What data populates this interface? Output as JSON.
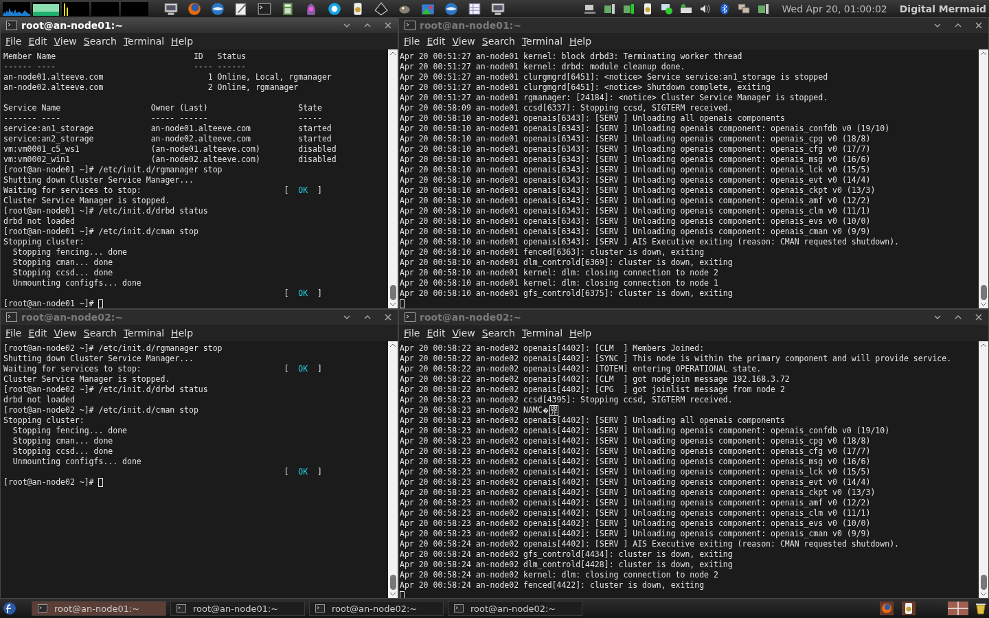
{
  "top_panel": {
    "clock": "Wed Apr 20, 01:00:02",
    "user": "Digital Mermaid"
  },
  "windows": [
    {
      "title": "root@an-node01:~",
      "active": true,
      "menu": [
        "File",
        "Edit",
        "View",
        "Search",
        "Terminal",
        "Help"
      ],
      "lines": [
        {
          "text": "Member Name                             ID   Status"
        },
        {
          "text": "------ ----                             ---- ------"
        },
        {
          "text": "an-node01.alteeve.com                      1 Online, Local, rgmanager"
        },
        {
          "text": "an-node02.alteeve.com                      2 Online, rgmanager"
        },
        {
          "kind": "blank"
        },
        {
          "text": "Service Name                   Owner (Last)                   State"
        },
        {
          "text": "------- ----                   ----- ------                   -----"
        },
        {
          "text": "service:an1_storage            an-node01.alteeve.com          started"
        },
        {
          "text": "service:an2_storage            an-node02.alteeve.com          started"
        },
        {
          "text": "vm:vm0001_c5_ws1               (an-node01.alteeve.com)        disabled"
        },
        {
          "text": "vm:vm0002_win1                 (an-node02.alteeve.com)        disabled"
        },
        {
          "text": "[root@an-node01 ~]# /etc/init.d/rgmanager stop"
        },
        {
          "text": "Shutting down Cluster Service Manager..."
        },
        {
          "text": "Waiting for services to stop:",
          "status": "[  OK  ]"
        },
        {
          "text": "Cluster Service Manager is stopped."
        },
        {
          "text": "[root@an-node01 ~]# /etc/init.d/drbd status"
        },
        {
          "text": "drbd not loaded"
        },
        {
          "text": "[root@an-node01 ~]# /etc/init.d/cman stop"
        },
        {
          "text": "Stopping cluster:"
        },
        {
          "text": "  Stopping fencing... done"
        },
        {
          "text": "  Stopping cman... done"
        },
        {
          "text": "  Stopping ccsd... done"
        },
        {
          "text": "  Unmounting configfs... done"
        },
        {
          "status": "[  OK  ]"
        },
        {
          "text": "[root@an-node01 ~]#",
          "cursor": true
        }
      ]
    },
    {
      "title": "root@an-node01:~",
      "active": false,
      "menu": [
        "File",
        "Edit",
        "View",
        "Search",
        "Terminal",
        "Help"
      ],
      "lines": [
        {
          "text": "Apr 20 00:51:27 an-node01 kernel: block drbd3: Terminating worker thread"
        },
        {
          "text": "Apr 20 00:51:27 an-node01 kernel: drbd: module cleanup done."
        },
        {
          "text": "Apr 20 00:51:27 an-node01 clurgmgrd[6451]: <notice> Service service:an1_storage is stopped"
        },
        {
          "text": "Apr 20 00:51:27 an-node01 clurgmgrd[6451]: <notice> Shutdown complete, exiting"
        },
        {
          "text": "Apr 20 00:51:27 an-node01 rgmanager: [24184]: <notice> Cluster Service Manager is stopped."
        },
        {
          "text": "Apr 20 00:58:09 an-node01 ccsd[6337]: Stopping ccsd, SIGTERM received."
        },
        {
          "text": "Apr 20 00:58:10 an-node01 openais[6343]: [SERV ] Unloading all openais components"
        },
        {
          "text": "Apr 20 00:58:10 an-node01 openais[6343]: [SERV ] Unloading openais component: openais_confdb v0 (19/10)"
        },
        {
          "text": "Apr 20 00:58:10 an-node01 openais[6343]: [SERV ] Unloading openais component: openais_cpg v0 (18/8)"
        },
        {
          "text": "Apr 20 00:58:10 an-node01 openais[6343]: [SERV ] Unloading openais component: openais_cfg v0 (17/7)"
        },
        {
          "text": "Apr 20 00:58:10 an-node01 openais[6343]: [SERV ] Unloading openais component: openais_msg v0 (16/6)"
        },
        {
          "text": "Apr 20 00:58:10 an-node01 openais[6343]: [SERV ] Unloading openais component: openais_lck v0 (15/5)"
        },
        {
          "text": "Apr 20 00:58:10 an-node01 openais[6343]: [SERV ] Unloading openais component: openais_evt v0 (14/4)"
        },
        {
          "text": "Apr 20 00:58:10 an-node01 openais[6343]: [SERV ] Unloading openais component: openais_ckpt v0 (13/3)"
        },
        {
          "text": "Apr 20 00:58:10 an-node01 openais[6343]: [SERV ] Unloading openais component: openais_amf v0 (12/2)"
        },
        {
          "text": "Apr 20 00:58:10 an-node01 openais[6343]: [SERV ] Unloading openais component: openais_clm v0 (11/1)"
        },
        {
          "text": "Apr 20 00:58:10 an-node01 openais[6343]: [SERV ] Unloading openais component: openais_evs v0 (10/0)"
        },
        {
          "text": "Apr 20 00:58:10 an-node01 openais[6343]: [SERV ] Unloading openais component: openais_cman v0 (9/9)"
        },
        {
          "text": "Apr 20 00:58:10 an-node01 openais[6343]: [SERV ] AIS Executive exiting (reason: CMAN requested shutdown)."
        },
        {
          "text": "Apr 20 00:58:10 an-node01 fenced[6363]: cluster is down, exiting"
        },
        {
          "text": "Apr 20 00:58:10 an-node01 dlm_controld[6369]: cluster is down, exiting"
        },
        {
          "text": "Apr 20 00:58:10 an-node01 kernel: dlm: closing connection to node 2"
        },
        {
          "text": "Apr 20 00:58:10 an-node01 kernel: dlm: closing connection to node 1"
        },
        {
          "text": "Apr 20 00:58:10 an-node01 gfs_controld[6375]: cluster is down, exiting"
        },
        {
          "cursor": true
        }
      ]
    },
    {
      "title": "root@an-node02:~",
      "active": false,
      "menu": [
        "File",
        "Edit",
        "View",
        "Search",
        "Terminal",
        "Help"
      ],
      "lines": [
        {
          "text": "[root@an-node02 ~]# /etc/init.d/rgmanager stop"
        },
        {
          "text": "Shutting down Cluster Service Manager..."
        },
        {
          "text": "Waiting for services to stop:",
          "status": "[  OK  ]"
        },
        {
          "text": "Cluster Service Manager is stopped."
        },
        {
          "text": "[root@an-node02 ~]# /etc/init.d/drbd status"
        },
        {
          "text": "drbd not loaded"
        },
        {
          "text": "[root@an-node02 ~]# /etc/init.d/cman stop"
        },
        {
          "text": "Stopping cluster:"
        },
        {
          "text": "  Stopping fencing... done"
        },
        {
          "text": "  Stopping cman... done"
        },
        {
          "text": "  Stopping ccsd... done"
        },
        {
          "text": "  Unmounting configfs... done"
        },
        {
          "status": "[  OK  ]"
        },
        {
          "text": "[root@an-node02 ~]#",
          "cursor": true
        }
      ]
    },
    {
      "title": "root@an-node02:~",
      "active": false,
      "menu": [
        "File",
        "Edit",
        "View",
        "Search",
        "Terminal",
        "Help"
      ],
      "lines": [
        {
          "text": "Apr 20 00:58:22 an-node02 openais[4402]: [CLM  ] Members Joined:"
        },
        {
          "text": "Apr 20 00:58:22 an-node02 openais[4402]: [SYNC ] This node is within the primary component and will provide service."
        },
        {
          "text": "Apr 20 00:58:22 an-node02 openais[4402]: [TOTEM] entering OPERATIONAL state."
        },
        {
          "text": "Apr 20 00:58:22 an-node02 openais[4402]: [CLM  ] got nodejoin message 192.168.3.72"
        },
        {
          "text": "Apr 20 00:58:22 an-node02 openais[4402]: [CPG  ] got joinlist message from node 2"
        },
        {
          "text": "Apr 20 00:58:23 an-node02 ccsd[4395]: Stopping ccsd, SIGTERM received."
        },
        {
          "text": "Apr 20 00:58:23 an-node02 NAMC",
          "kind": "bad_char",
          "hexbox": [
            "00",
            "7F"
          ]
        },
        {
          "text": "Apr 20 00:58:23 an-node02 openais[4402]: [SERV ] Unloading all openais components"
        },
        {
          "text": "Apr 20 00:58:23 an-node02 openais[4402]: [SERV ] Unloading openais component: openais_confdb v0 (19/10)"
        },
        {
          "text": "Apr 20 00:58:23 an-node02 openais[4402]: [SERV ] Unloading openais component: openais_cpg v0 (18/8)"
        },
        {
          "text": "Apr 20 00:58:23 an-node02 openais[4402]: [SERV ] Unloading openais component: openais_cfg v0 (17/7)"
        },
        {
          "text": "Apr 20 00:58:23 an-node02 openais[4402]: [SERV ] Unloading openais component: openais_msg v0 (16/6)"
        },
        {
          "text": "Apr 20 00:58:23 an-node02 openais[4402]: [SERV ] Unloading openais component: openais_lck v0 (15/5)"
        },
        {
          "text": "Apr 20 00:58:23 an-node02 openais[4402]: [SERV ] Unloading openais component: openais_evt v0 (14/4)"
        },
        {
          "text": "Apr 20 00:58:23 an-node02 openais[4402]: [SERV ] Unloading openais component: openais_ckpt v0 (13/3)"
        },
        {
          "text": "Apr 20 00:58:23 an-node02 openais[4402]: [SERV ] Unloading openais component: openais_amf v0 (12/2)"
        },
        {
          "text": "Apr 20 00:58:23 an-node02 openais[4402]: [SERV ] Unloading openais component: openais_clm v0 (11/1)"
        },
        {
          "text": "Apr 20 00:58:23 an-node02 openais[4402]: [SERV ] Unloading openais component: openais_evs v0 (10/0)"
        },
        {
          "text": "Apr 20 00:58:23 an-node02 openais[4402]: [SERV ] Unloading openais component: openais_cman v0 (9/9)"
        },
        {
          "text": "Apr 20 00:58:24 an-node02 openais[4402]: [SERV ] AIS Executive exiting (reason: CMAN requested shutdown)."
        },
        {
          "text": "Apr 20 00:58:24 an-node02 gfs_controld[4434]: cluster is down, exiting"
        },
        {
          "text": "Apr 20 00:58:24 an-node02 dlm_controld[4428]: cluster is down, exiting"
        },
        {
          "text": "Apr 20 00:58:24 an-node02 kernel: dlm: closing connection to node 2"
        },
        {
          "text": "Apr 20 00:58:24 an-node02 fenced[4422]: cluster is down, exiting"
        },
        {
          "cursor": true
        }
      ]
    }
  ],
  "taskbar": [
    {
      "label": "root@an-node01:~",
      "selected": true
    },
    {
      "label": "root@an-node01:~",
      "selected": false
    },
    {
      "label": "root@an-node02:~",
      "selected": false
    },
    {
      "label": "root@an-node02:~",
      "selected": false
    }
  ]
}
